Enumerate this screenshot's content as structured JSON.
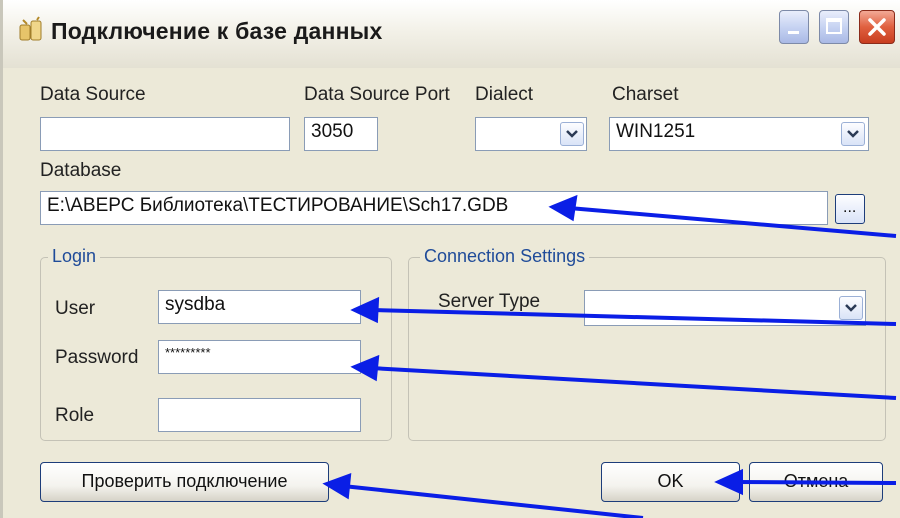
{
  "window": {
    "title": "Подключение к базе данных"
  },
  "fields": {
    "data_source": {
      "label": "Data Source",
      "value": ""
    },
    "data_source_port": {
      "label": "Data Source Port",
      "value": "3050"
    },
    "dialect": {
      "label": "Dialect",
      "value": ""
    },
    "charset": {
      "label": "Charset",
      "value": "WIN1251"
    },
    "database": {
      "label": "Database",
      "value": "E:\\АВЕРС Библиотека\\ТЕСТИРОВАНИЕ\\Sch17.GDB",
      "browse_label": "..."
    }
  },
  "login": {
    "title": "Login",
    "user_label": "User",
    "user_value": "sysdba",
    "password_label": "Password",
    "password_value": "*********",
    "role_label": "Role",
    "role_value": ""
  },
  "connection_settings": {
    "title": "Connection Settings",
    "server_type_label": "Server Type",
    "server_type_value": ""
  },
  "buttons": {
    "test_connection": "Проверить подключение",
    "ok": "OK",
    "cancel": "Отмена"
  },
  "colors": {
    "arrow": "#0a1ee6",
    "title_close": "#d9502f",
    "group_title": "#1f4b99"
  },
  "icons": [
    "app-icon",
    "minimize-icon",
    "maximize-icon",
    "close-icon",
    "chevron-down-icon"
  ]
}
